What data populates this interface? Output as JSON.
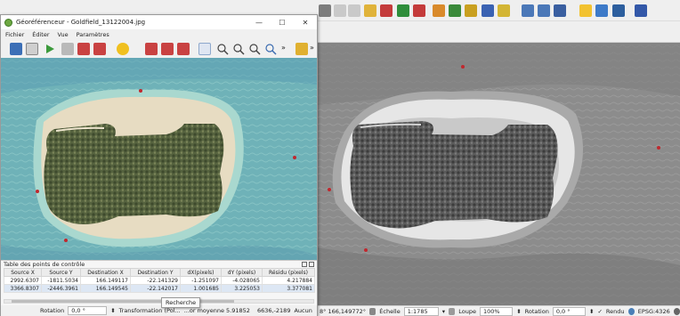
{
  "geo_window": {
    "title": "Géoréférenceur - Goldfield_13122004.jpg",
    "controls": {
      "minimize": "—",
      "maximize": "☐",
      "close": "✕"
    },
    "menu": [
      "Fichier",
      "Éditer",
      "Vue",
      "Paramètres"
    ],
    "toolbar_overflow": "»"
  },
  "gcp_panel": {
    "title": "Table des points de contrôle",
    "columns": [
      "Source X",
      "Source Y",
      "Destination X",
      "Destination Y",
      "dX(pixels)",
      "dY (pixels)",
      "Résidu (pixels)"
    ],
    "rows": [
      [
        "2992.6307",
        "-1811.5034",
        "166.149117",
        "-22.141329",
        "-1.251097",
        "-4.028065",
        "4.217884"
      ],
      [
        "3366.8307",
        "-2446.3961",
        "166.149545",
        "-22.142017",
        "1.001685",
        "3.225053",
        "3.377081"
      ]
    ]
  },
  "geo_status": {
    "rotation_label": "Rotation",
    "rotation_value": "0,0 °",
    "transform_text": "Transformation (Pol...",
    "mean_text": "...or moyenne 5.91852",
    "coords": "6636,-2189",
    "crs": "Aucun"
  },
  "tooltip": "Recherche",
  "main_status": {
    "coord_fragment": "8° 166,149772°",
    "scale_label": "Échelle",
    "scale_value": "1:1785",
    "magnifier_label": "Loupe",
    "magnifier_value": "100%",
    "rotation_label": "Rotation",
    "rotation_value": "0,0 °",
    "render_label": "Rendu",
    "render_checked": "✓",
    "crs": "EPSG:4326"
  },
  "colors": {
    "sea_turquoise": "#7cc4c0",
    "sea_deep": "#4f9bb0",
    "sand": "#e7dcc2",
    "vegetation": "#5d6a45",
    "gcp_marker": "#c0282e",
    "accent_blue": "#2c6db8"
  }
}
